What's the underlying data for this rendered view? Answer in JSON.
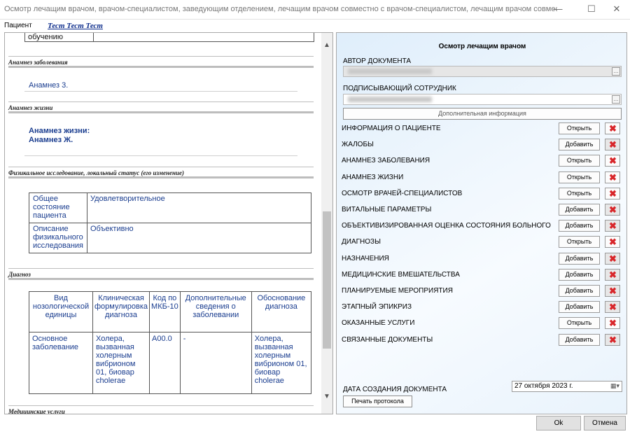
{
  "window": {
    "title": "Осмотр лечащим врачом, врачом-специалистом, заведующим отделением, лечащим врачом совместно с врачом-специалистом, лечащим врачом совместно с заведую...",
    "minimize": "—",
    "maximize": "☐",
    "close": "✕"
  },
  "patient": {
    "label": "Пациент",
    "name": "Тест Тест Тест"
  },
  "document": {
    "top_fragment": "обучению",
    "sections": [
      {
        "title": "Анамнез заболевания",
        "text": "Анамнез 3."
      },
      {
        "title": "Анамнез жизни",
        "text_line1": "Анамнез жизни:",
        "text_line2": "Анамнез Ж."
      },
      {
        "title": "Физикальное исследование, локальный статус (его изменение)"
      },
      {
        "title": "Диагноз"
      },
      {
        "title": "Медицинские услуги"
      }
    ],
    "physical_table": [
      {
        "label": "Общее состояние пациента",
        "value": "Удовлетворительное"
      },
      {
        "label": "Описание физикального исследования",
        "value": "Объективно"
      }
    ],
    "diagnosis_table": {
      "headers": [
        "Вид нозологической единицы",
        "Клиническая формулировка диагноза",
        "Код по МКБ-10",
        "Дополнительные сведения о заболевании",
        "Обоснование диагноза"
      ],
      "row": [
        "Основное заболевание",
        "Холера, вызванная холерным вибрионом 01, биовар cholerae",
        "A00.0",
        "-",
        "Холера, вызванная холерным вибрионом 01, биовар cholerae"
      ]
    },
    "scroll_up": "▲",
    "scroll_down": "▼"
  },
  "form": {
    "title": "Осмотр лечащим врачом",
    "author_label": "АВТОР ДОКУМЕНТА",
    "signer_label": "ПОДПИСЫВАЮЩИЙ СОТРУДНИК",
    "ellipsis": "...",
    "additional_info": "Дополнительная информация",
    "rows": [
      {
        "label": "ИНФОРМАЦИЯ О ПАЦИЕНТЕ",
        "action": "Открыть",
        "delete_enabled": true
      },
      {
        "label": "ЖАЛОБЫ",
        "action": "Добавить",
        "delete_enabled": false
      },
      {
        "label": "АНАМНЕЗ ЗАБОЛЕВАНИЯ",
        "action": "Открыть",
        "delete_enabled": true
      },
      {
        "label": "АНАМНЕЗ ЖИЗНИ",
        "action": "Открыть",
        "delete_enabled": true
      },
      {
        "label": "ОСМОТР ВРАЧЕЙ-СПЕЦИАЛИСТОВ",
        "action": "Открыть",
        "delete_enabled": true
      },
      {
        "label": "ВИТАЛЬНЫЕ ПАРАМЕТРЫ",
        "action": "Добавить",
        "delete_enabled": false
      },
      {
        "label": "ОБЪЕКТИВИЗИРОВАННАЯ ОЦЕНКА СОСТОЯНИЯ БОЛЬНОГО",
        "action": "Добавить",
        "delete_enabled": false
      },
      {
        "label": "ДИАГНОЗЫ",
        "action": "Открыть",
        "delete_enabled": true
      },
      {
        "label": "НАЗНАЧЕНИЯ",
        "action": "Добавить",
        "delete_enabled": false
      },
      {
        "label": "МЕДИЦИНСКИЕ ВМЕШАТЕЛЬСТВА",
        "action": "Добавить",
        "delete_enabled": false
      },
      {
        "label": "ПЛАНИРУЕМЫЕ МЕРОПРИЯТИЯ",
        "action": "Добавить",
        "delete_enabled": false
      },
      {
        "label": "ЭТАПНЫЙ ЭПИКРИЗ",
        "action": "Добавить",
        "delete_enabled": false
      },
      {
        "label": "ОКАЗАННЫЕ УСЛУГИ",
        "action": "Открыть",
        "delete_enabled": true
      },
      {
        "label": "СВЯЗАННЫЕ ДОКУМЕНТЫ",
        "action": "Добавить",
        "delete_enabled": false
      }
    ],
    "delete_icon": "✖",
    "date_label": "ДАТА СОЗДАНИЯ ДОКУМЕНТА",
    "date_value": "27 октября 2023 г.",
    "calendar_icon": "▦▾",
    "print_button": "Печать протокола"
  },
  "footer": {
    "ok": "Ok",
    "cancel": "Отмена"
  }
}
